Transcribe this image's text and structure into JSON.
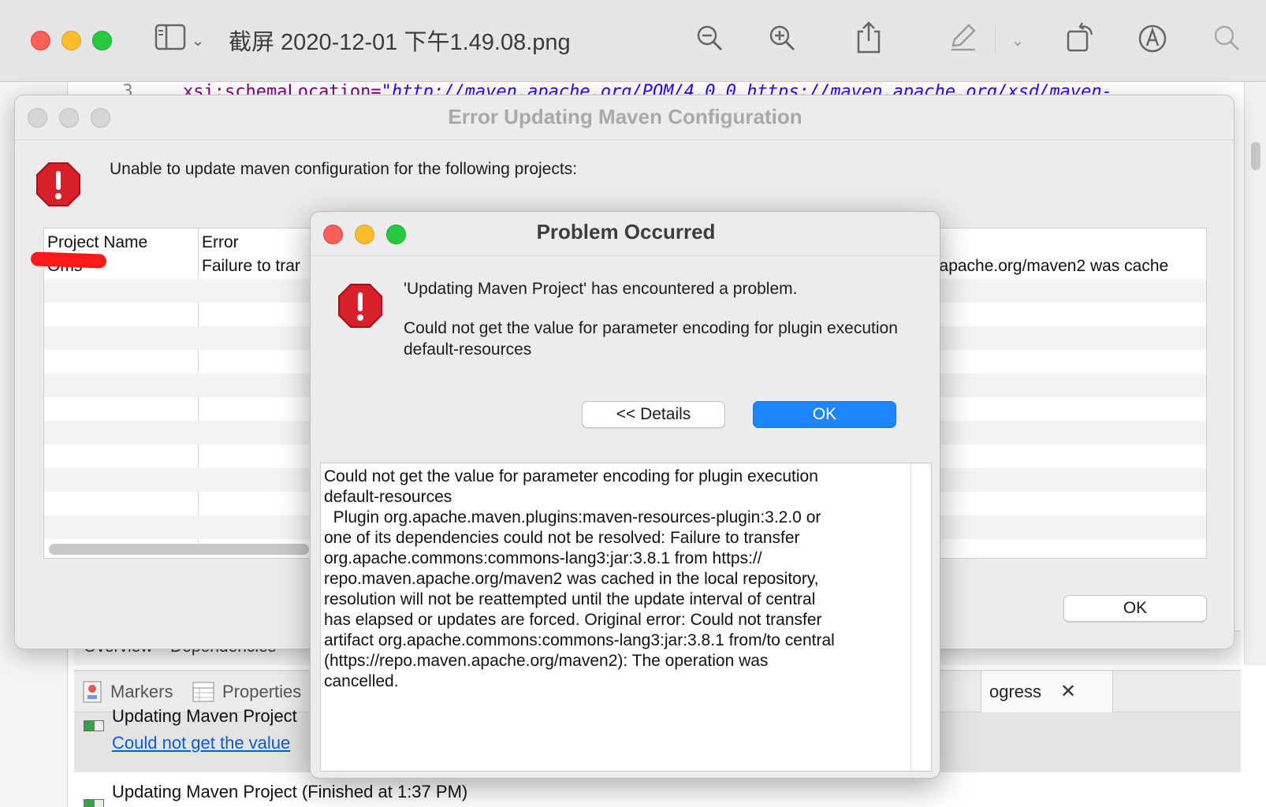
{
  "preview": {
    "title": "截屏 2020-12-01 下午1.49.08.png",
    "icons": [
      "sidebar-icon",
      "chevron-down-icon",
      "zoom-out-icon",
      "zoom-in-icon",
      "share-icon",
      "markup-pen-icon",
      "rotate-icon",
      "annotate-icon",
      "search-icon"
    ]
  },
  "editor": {
    "line_number": "3",
    "attr": "xsi:schemaLocation=",
    "value": "\"http://maven.apache.org/POM/4.0.0 https://maven.apache.org/xsd/maven-",
    "tabs": [
      "Overview",
      "Dependencies"
    ]
  },
  "views": {
    "markers": "Markers",
    "properties": "Properties",
    "progress": "ogress",
    "progress_item1_title": "Updating Maven Project",
    "progress_item1_link": "Could not get the value",
    "progress_item2_title": "Updating Maven Project (Finished at 1:37 PM)"
  },
  "error_dialog": {
    "title": "Error Updating Maven Configuration",
    "message": "Unable to update maven configuration for the following projects:",
    "columns": [
      "Project Name",
      "Error"
    ],
    "row": {
      "project": "Oms",
      "error_visible_start": "Failure to trar",
      "error_visible_end": "n.apache.org/maven2 was cache"
    },
    "ok_label": "OK"
  },
  "problem_dialog": {
    "title": "Problem Occurred",
    "headline": "'Updating Maven Project' has encountered a problem.",
    "summary": "Could not get the value for parameter encoding for plugin execution default-resources",
    "details_label": "<< Details",
    "ok_label": "OK",
    "details_text": "Could not get the value for parameter encoding for plugin execution\ndefault-resources\n  Plugin org.apache.maven.plugins:maven-resources-plugin:3.2.0 or\none of its dependencies could not be resolved: Failure to transfer\norg.apache.commons:commons-lang3:jar:3.8.1 from https://\nrepo.maven.apache.org/maven2 was cached in the local repository,\nresolution will not be reattempted until the update interval of central\nhas elapsed or updates are forced. Original error: Could not transfer\nartifact org.apache.commons:commons-lang3:jar:3.8.1 from/to central\n(https://repo.maven.apache.org/maven2): The operation was\ncancelled."
  },
  "colors": {
    "accent_blue": "#1f85ff",
    "error_red": "#d8202a",
    "close_red": "#fe5f57",
    "minimize_yellow": "#febc2e",
    "zoom_green": "#28c840",
    "link_blue": "#0a5bd6"
  }
}
